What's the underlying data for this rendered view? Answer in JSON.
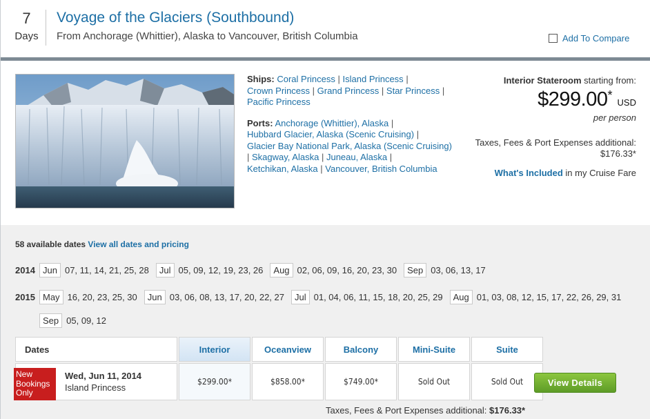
{
  "header": {
    "days_number": "7",
    "days_label": "Days",
    "title": "Voyage of the Glaciers (Southbound)",
    "route": "From Anchorage (Whittier), Alaska to Vancouver, British Columbia",
    "compare_label": "Add To Compare"
  },
  "overview": {
    "ships_label": "Ships:",
    "ships": [
      "Coral Princess",
      "Island Princess",
      "Crown Princess",
      "Grand Princess",
      "Star Princess",
      "Pacific Princess"
    ],
    "ports_label": "Ports:",
    "ports": [
      "Anchorage (Whittier), Alaska",
      "Hubbard Glacier, Alaska (Scenic Cruising)",
      "Glacier Bay National Park, Alaska (Scenic Cruising)",
      "Skagway, Alaska",
      "Juneau, Alaska",
      "Ketchikan, Alaska",
      "Vancouver, British Columbia"
    ],
    "separator": "|"
  },
  "pricing": {
    "stateroom_label": "Interior Stateroom",
    "starting_from": "starting from:",
    "price": "$299.00",
    "asterisk": "*",
    "currency": "USD",
    "per_person": "per person",
    "taxes_text": "Taxes, Fees & Port Expenses additional:",
    "taxes_amount": "$176.33*",
    "whats_included_link": "What's Included",
    "whats_included_rest": "in my Cruise Fare"
  },
  "dates": {
    "count_text": "58 available dates",
    "view_all_link": "View all dates and pricing",
    "years": [
      {
        "year": "2014",
        "months": [
          {
            "month": "Jun",
            "days": "07, 11, 14, 21, 25, 28"
          },
          {
            "month": "Jul",
            "days": "05, 09, 12, 19, 23, 26"
          },
          {
            "month": "Aug",
            "days": "02, 06, 09, 16, 20, 23, 30"
          },
          {
            "month": "Sep",
            "days": "03, 06, 13, 17"
          }
        ]
      },
      {
        "year": "2015",
        "months": [
          {
            "month": "May",
            "days": "16, 20, 23, 25, 30"
          },
          {
            "month": "Jun",
            "days": "03, 06, 08, 13, 17, 20, 22, 27"
          },
          {
            "month": "Jul",
            "days": "01, 04, 06, 11, 15, 18, 20, 25, 29"
          },
          {
            "month": "Aug",
            "days": "01, 03, 08, 12, 15, 17, 22, 26, 29, 31"
          },
          {
            "month": "Sep",
            "days": "05, 09, 12"
          }
        ]
      }
    ]
  },
  "table": {
    "headers": {
      "dates": "Dates",
      "interior": "Interior",
      "oceanview": "Oceanview",
      "balcony": "Balcony",
      "mini_suite": "Mini-Suite",
      "suite": "Suite"
    },
    "row": {
      "badge": "New Bookings Only",
      "date": "Wed, Jun 11, 2014",
      "ship": "Island Princess",
      "interior": "$299.00*",
      "oceanview": "$858.00*",
      "balcony": "$749.00*",
      "mini_suite": "Sold Out",
      "suite": "Sold Out",
      "button": "View Details"
    },
    "taxes_label": "Taxes, Fees & Port Expenses additional:",
    "taxes_amount": "$176.33*"
  },
  "colors": {
    "link": "#1d6fa5",
    "badge": "#c81e1e",
    "button": "#6aaa2e",
    "divider": "#7d8a94"
  }
}
